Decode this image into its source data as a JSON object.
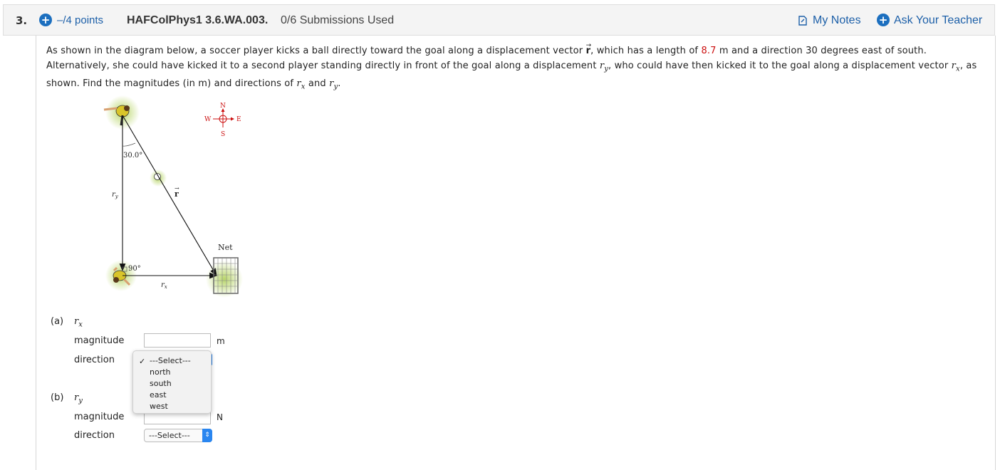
{
  "header": {
    "number": "3.",
    "points": "–/4 points",
    "question_id": "HAFColPhys1 3.6.WA.003.",
    "submissions": "0/6 Submissions Used",
    "my_notes": "My Notes",
    "ask_teacher": "Ask Your Teacher"
  },
  "question": {
    "p1": "As shown in the diagram below, a soccer player kicks a ball directly toward the goal along a displacement vector ",
    "r_symbol": "r",
    "p2": ", which has a length of ",
    "length_value": "8.7",
    "p3": " m and a direction 30 degrees east of south. Alternatively, she could have kicked it to a second player standing directly in front of the goal along a displacement ",
    "ry": "r",
    "ry_sub": "y",
    "p4": ", who could have then kicked it to the goal along a displacement vector ",
    "rx": "r",
    "rx_sub": "x",
    "p5": ", as shown. Find the magnitudes (in m) and directions of ",
    "rx2": "r",
    "rx2_sub": "x",
    "p6": " and ",
    "ry2": "r",
    "ry2_sub": "y",
    "p7": "."
  },
  "diagram": {
    "compass_n": "N",
    "compass_w": "W",
    "compass_e": "E",
    "compass_s": "S",
    "angle_top": "30.0°",
    "angle_bottom": "90°",
    "ry_label": "r",
    "ry_label_sub": "y",
    "rx_label": "r",
    "rx_label_sub": "x",
    "r_label": "r",
    "net_label": "Net",
    "accent_color": "#cc1111"
  },
  "part_a": {
    "label": "(a)",
    "var": "r",
    "sub": "x",
    "magnitude_label": "magnitude",
    "magnitude_value": "",
    "unit": "m",
    "direction_label": "direction"
  },
  "part_b": {
    "label": "(b)",
    "var": "r",
    "sub": "y",
    "magnitude_label": "magnitude",
    "magnitude_value": "",
    "unit": "N",
    "direction_label": "direction",
    "select_value": "---Select---"
  },
  "dropdown": {
    "options": [
      "---Select---",
      "north",
      "south",
      "east",
      "west"
    ],
    "selected": "---Select---"
  }
}
